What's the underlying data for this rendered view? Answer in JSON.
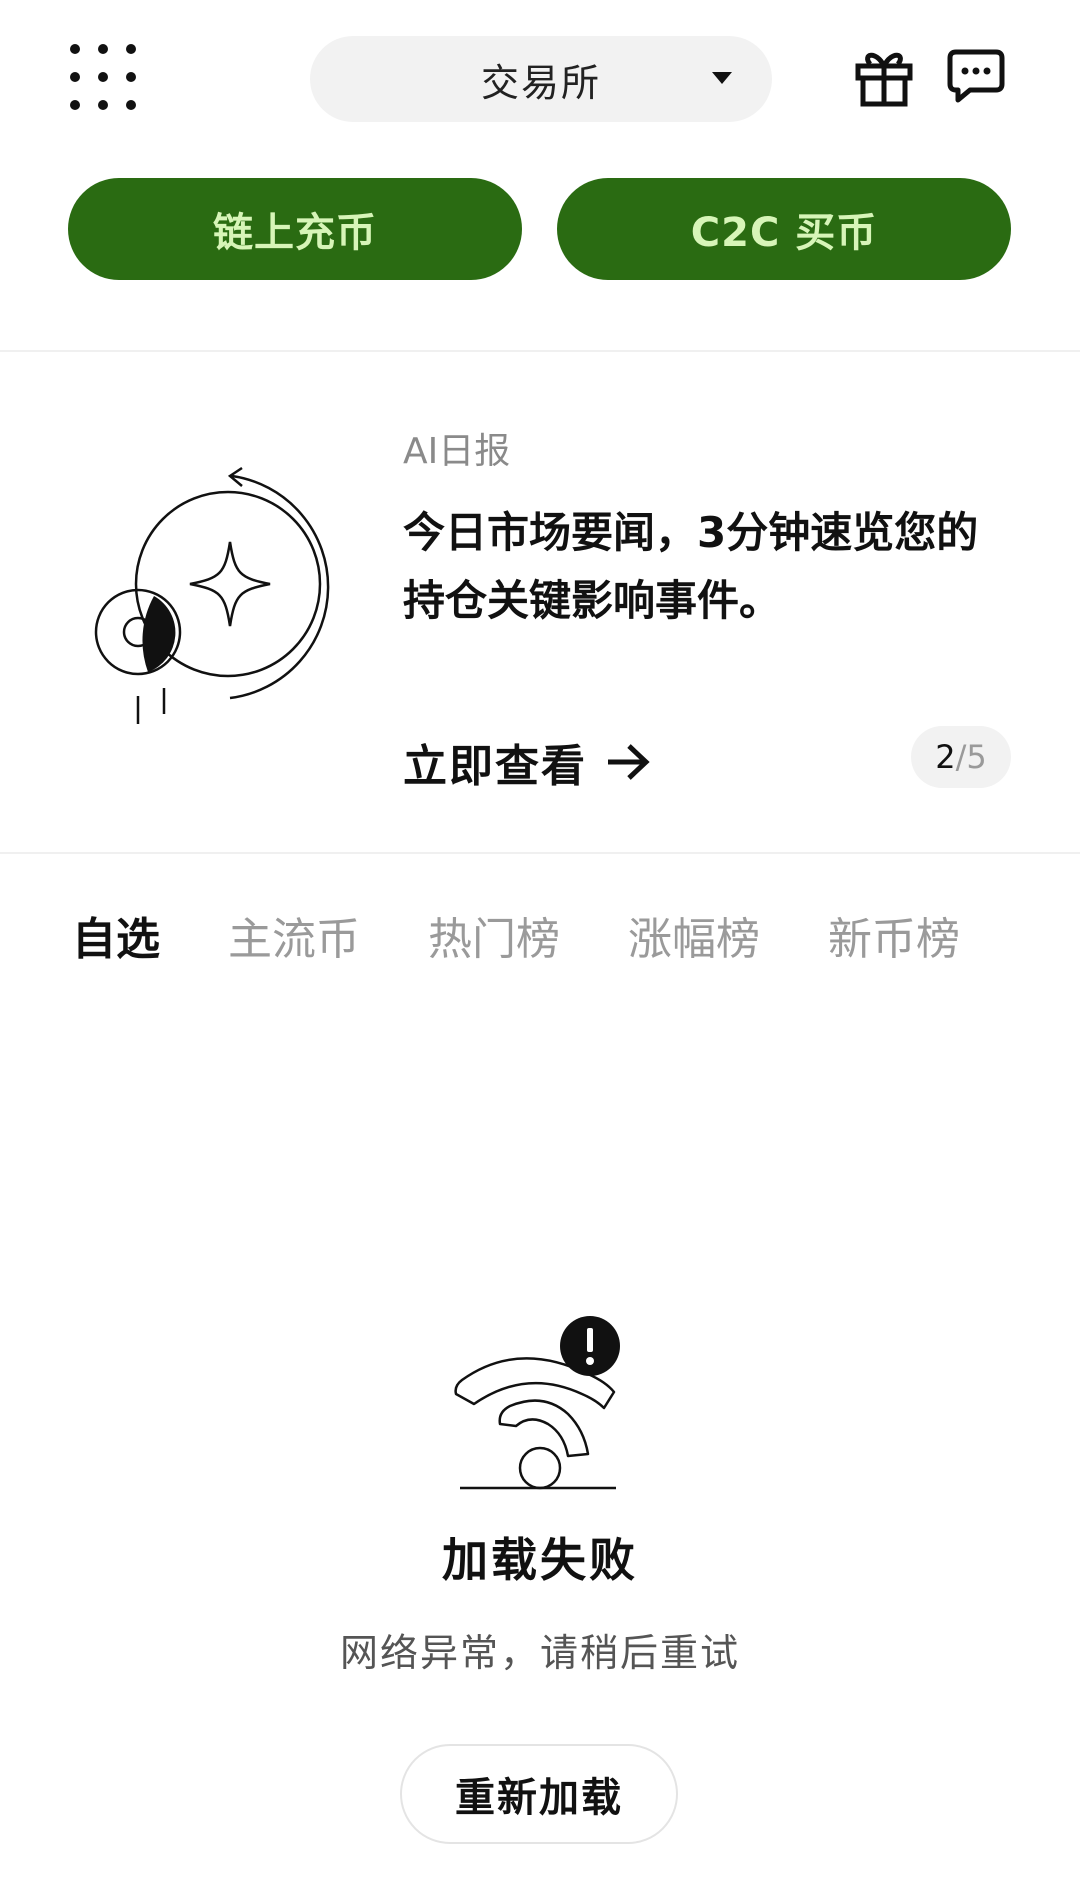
{
  "header": {
    "menu_icon": "grid-menu-icon",
    "mode_selector": {
      "selected": "交易所",
      "icon": "caret-down-icon"
    },
    "gift_icon": "gift-icon",
    "message_icon": "chat-bubble-icon"
  },
  "actions": {
    "deposit_label": "链上充币",
    "c2c_label": "C2C 买币",
    "button_color": "#2a6b12",
    "button_text_color": "#d7f5b8"
  },
  "banner": {
    "tag": "AI日报",
    "headline": "今日市场要闻，3分钟速览您的持仓关键影响事件。",
    "cta_label": "立即查看",
    "cta_icon": "arrow-right-icon",
    "illustration_icon": "coin-sparkle-illustration",
    "page": {
      "current": "2",
      "separator": "/",
      "total": "5"
    }
  },
  "tabs": [
    {
      "label": "自选",
      "active": true
    },
    {
      "label": "主流币",
      "active": false
    },
    {
      "label": "热门榜",
      "active": false
    },
    {
      "label": "涨幅榜",
      "active": false
    },
    {
      "label": "新币榜",
      "active": false
    }
  ],
  "error_state": {
    "icon": "wifi-error-icon",
    "title": "加载失败",
    "subtitle": "网络异常，请稍后重试",
    "retry_label": "重新加载"
  }
}
